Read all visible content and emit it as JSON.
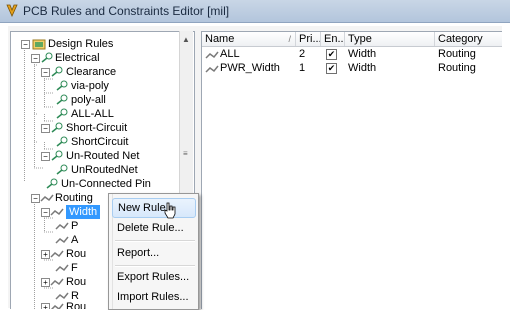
{
  "window": {
    "title": "PCB Rules and Constraints Editor [mil]"
  },
  "tree": {
    "nodes": [
      {
        "label": "Design Rules",
        "icon": "design-rules-folder-icon",
        "expander": "−"
      },
      {
        "label": "Electrical",
        "icon": "electrical-category-icon",
        "expander": "−"
      },
      {
        "label": "Clearance",
        "icon": "rule-type-icon",
        "expander": "−"
      },
      {
        "label": "via-poly",
        "icon": "rule-icon",
        "expander": ""
      },
      {
        "label": "poly-all",
        "icon": "rule-icon",
        "expander": ""
      },
      {
        "label": "ALL-ALL",
        "icon": "rule-icon",
        "expander": ""
      },
      {
        "label": "Short-Circuit",
        "icon": "rule-type-icon",
        "expander": "−"
      },
      {
        "label": "ShortCircuit",
        "icon": "rule-icon",
        "expander": ""
      },
      {
        "label": "Un-Routed Net",
        "icon": "rule-type-icon",
        "expander": "−"
      },
      {
        "label": "UnRoutedNet",
        "icon": "rule-icon",
        "expander": ""
      },
      {
        "label": "Un-Connected Pin",
        "icon": "rule-type-icon",
        "expander": ""
      },
      {
        "label": "Routing",
        "icon": "routing-category-icon",
        "expander": "−"
      },
      {
        "label": "Width",
        "icon": "routing-rule-type-icon",
        "expander": "−"
      },
      {
        "label": "P",
        "icon": "routing-rule-icon",
        "expander": ""
      },
      {
        "label": "A",
        "icon": "routing-rule-icon",
        "expander": ""
      },
      {
        "label": "Rou",
        "icon": "routing-rule-type-icon",
        "expander": "+"
      },
      {
        "label": "F",
        "icon": "routing-rule-icon",
        "expander": ""
      },
      {
        "label": "Rou",
        "icon": "routing-rule-type-icon",
        "expander": "+"
      },
      {
        "label": "R",
        "icon": "routing-rule-icon",
        "expander": ""
      },
      {
        "label": "Rou",
        "icon": "routing-rule-type-icon",
        "expander": "+"
      }
    ]
  },
  "grid": {
    "columns": [
      {
        "label": "Name",
        "sort": "/"
      },
      {
        "label": "Pri..."
      },
      {
        "label": "En..."
      },
      {
        "label": "Type"
      },
      {
        "label": "Category"
      }
    ],
    "rows": [
      {
        "name": "ALL",
        "priority": "2",
        "enabled": "✔",
        "type": "Width",
        "category": "Routing"
      },
      {
        "name": "PWR_Width",
        "priority": "1",
        "enabled": "✔",
        "type": "Width",
        "category": "Routing"
      }
    ]
  },
  "context_menu": {
    "items": [
      {
        "label": "New Rule...",
        "state": "hover"
      },
      {
        "label": "Delete Rule..."
      },
      {
        "label": "Report..."
      },
      {
        "label": "Export Rules..."
      },
      {
        "label": "Import Rules..."
      }
    ]
  },
  "colors": {
    "selection": "#3399ff",
    "menu_hover": "#d7e8fb",
    "rule_icon": "#2e8b57"
  }
}
